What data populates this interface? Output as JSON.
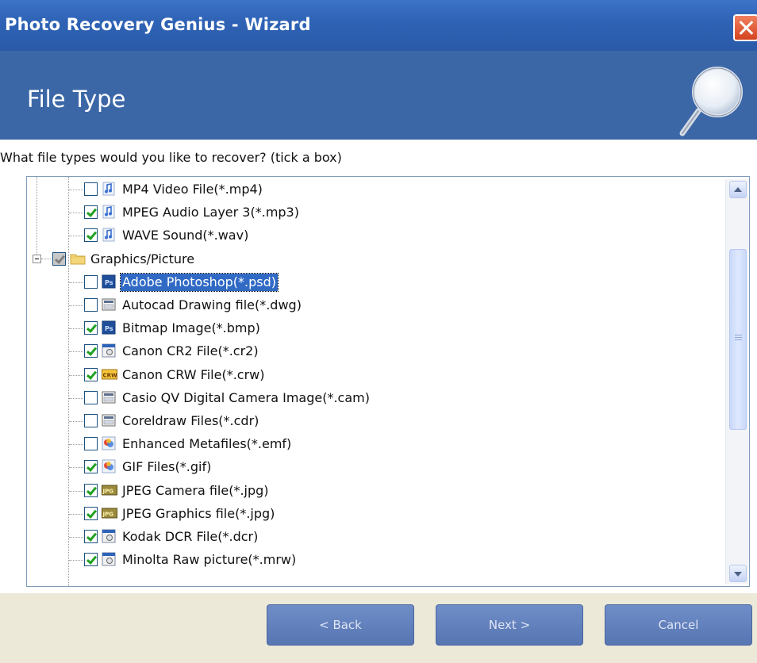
{
  "window": {
    "title": "Photo Recovery Genius - Wizard"
  },
  "header": {
    "heading": "File Type"
  },
  "prompt": "What file types would you like to recover? (tick a box)",
  "tree": {
    "items": [
      {
        "label": "MP4 Video File(*.mp4)",
        "checked": false,
        "icon": "audio-file-icon"
      },
      {
        "label": "MPEG Audio Layer 3(*.mp3)",
        "checked": true,
        "icon": "audio-file-icon"
      },
      {
        "label": "WAVE Sound(*.wav)",
        "checked": true,
        "icon": "audio-file-icon"
      },
      {
        "label": "Graphics/Picture",
        "checked": "partial",
        "icon": "folder-icon",
        "group": true,
        "expanded": true
      },
      {
        "label": "Adobe Photoshop(*.psd)",
        "checked": false,
        "icon": "photoshop-file-icon",
        "selected": true
      },
      {
        "label": "Autocad Drawing file(*.dwg)",
        "checked": false,
        "icon": "image-file-icon"
      },
      {
        "label": "Bitmap Image(*.bmp)",
        "checked": true,
        "icon": "photoshop-file-icon"
      },
      {
        "label": "Canon CR2 File(*.cr2)",
        "checked": true,
        "icon": "raw-file-icon"
      },
      {
        "label": "Canon CRW File(*.crw)",
        "checked": true,
        "icon": "crw-file-icon"
      },
      {
        "label": "Casio QV Digital Camera Image(*.cam)",
        "checked": false,
        "icon": "image-file-icon"
      },
      {
        "label": "Coreldraw Files(*.cdr)",
        "checked": false,
        "icon": "image-file-icon"
      },
      {
        "label": "Enhanced Metafiles(*.emf)",
        "checked": false,
        "icon": "metafile-icon"
      },
      {
        "label": "GIF Files(*.gif)",
        "checked": true,
        "icon": "metafile-icon"
      },
      {
        "label": "JPEG Camera file(*.jpg)",
        "checked": true,
        "icon": "jpeg-file-icon"
      },
      {
        "label": "JPEG Graphics file(*.jpg)",
        "checked": true,
        "icon": "jpeg-file-icon"
      },
      {
        "label": "Kodak DCR File(*.dcr)",
        "checked": true,
        "icon": "raw-file-icon"
      },
      {
        "label": "Minolta Raw picture(*.mrw)",
        "checked": true,
        "icon": "raw-file-icon"
      }
    ]
  },
  "buttons": {
    "back": "< Back",
    "next": "Next >",
    "cancel": "Cancel"
  }
}
